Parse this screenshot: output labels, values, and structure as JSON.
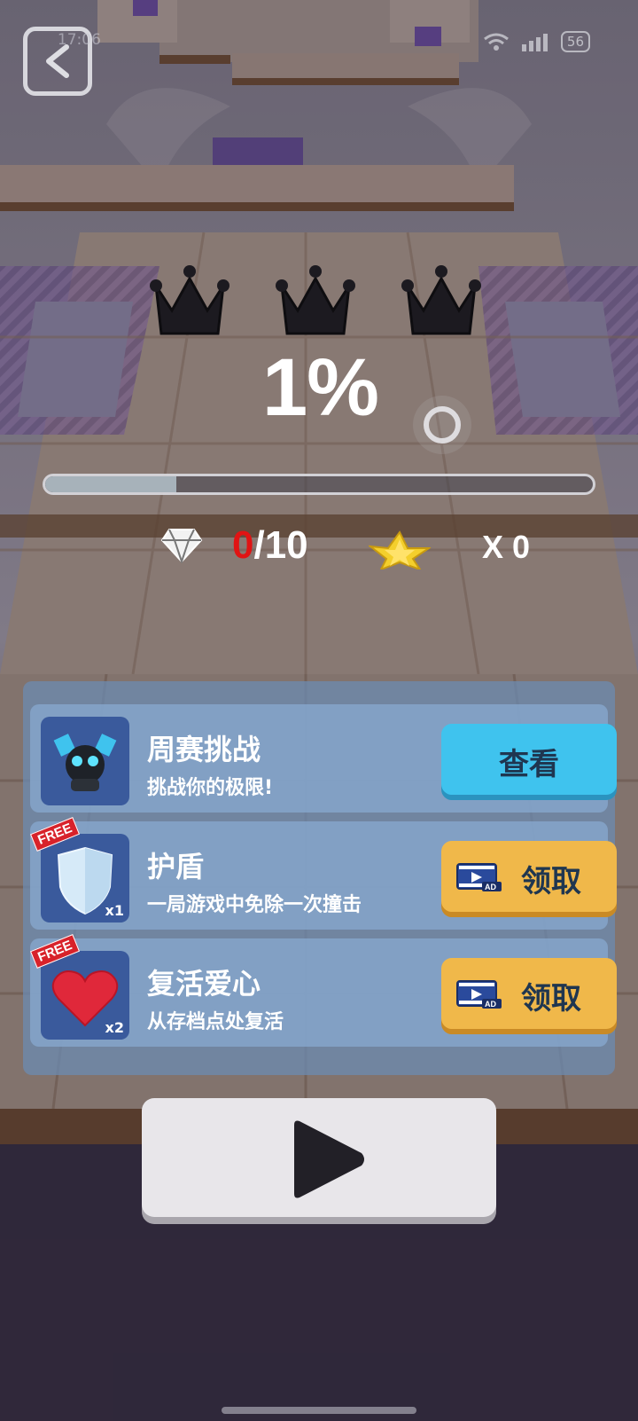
{
  "status_bar": {
    "clock": "17:06",
    "battery": "56"
  },
  "progress": {
    "percent_label": "1%",
    "fraction": 0.24
  },
  "crowns": {
    "earned": 0,
    "total": 3
  },
  "gems": {
    "current": "0",
    "separator_total": "/10"
  },
  "stars": {
    "label": "X 0"
  },
  "offers": [
    {
      "title": "周赛挑战",
      "desc": "挑战你的极限!",
      "button": "查看",
      "free": false,
      "multiplier": ""
    },
    {
      "title": "护盾",
      "desc": "一局游戏中免除一次撞击",
      "button": "领取",
      "free": true,
      "badge": "FREE",
      "multiplier": "x1"
    },
    {
      "title": "复活爱心",
      "desc": "从存档点处复活",
      "button": "领取",
      "free": true,
      "badge": "FREE",
      "multiplier": "x2"
    }
  ],
  "icons": {
    "back": "back-arrow-icon",
    "crown": "crown-icon",
    "gem": "diamond-icon",
    "star": "star-icon",
    "ad": "video-ad-icon",
    "play": "play-icon"
  },
  "colors": {
    "view_button": "#3fc3ee",
    "claim_button": "#f0b84a",
    "gem_current": "#e01414",
    "panel": "#6b8cb4"
  }
}
